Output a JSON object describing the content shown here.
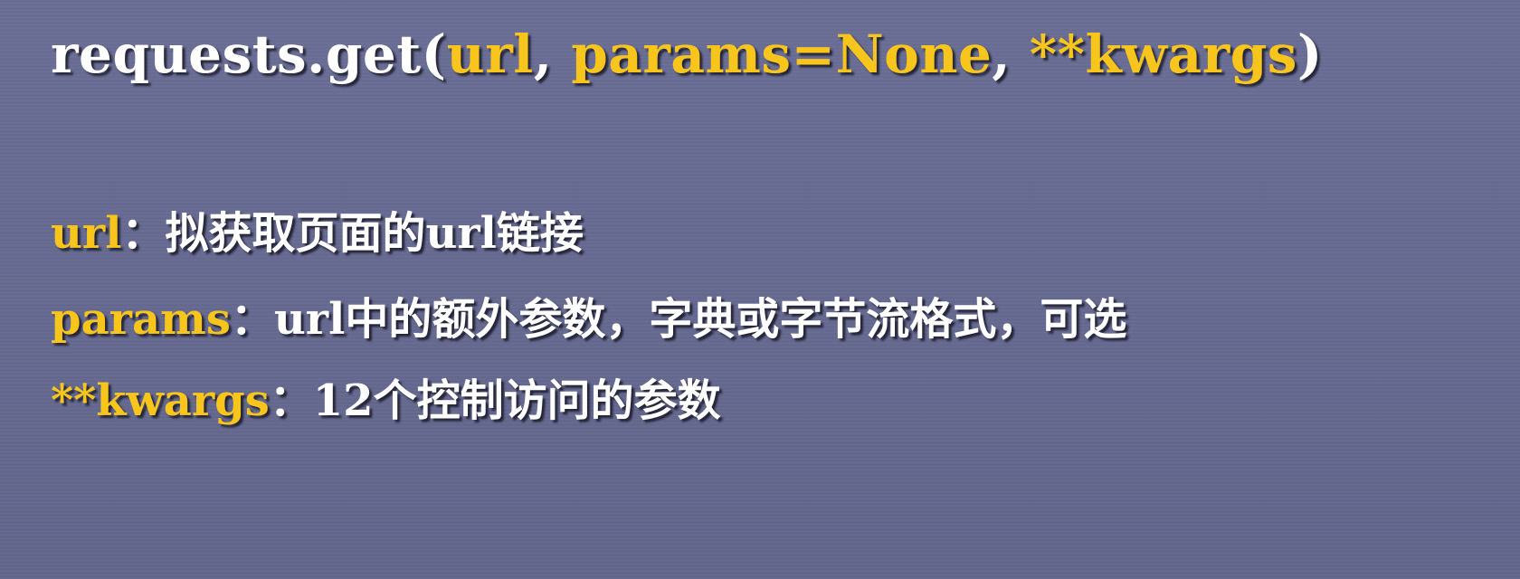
{
  "slide": {
    "signature": {
      "prefix": "requests.get(",
      "arg1": "url",
      "sep1": ", ",
      "arg2": "params=None",
      "sep2": ", ",
      "arg3": "**kwargs",
      "suffix": ")"
    },
    "params": [
      {
        "name": "url",
        "colon": "：",
        "desc_parts": [
          "拟获取页面的",
          "url",
          "链接"
        ]
      },
      {
        "name": "params",
        "colon": "：",
        "desc_parts": [
          "url",
          "中的额外参数，字典或字节流格式，可选"
        ]
      },
      {
        "name": "**kwargs",
        "colon": "：",
        "desc_parts": [
          "12",
          "个控制访问的参数"
        ]
      }
    ],
    "colors": {
      "background": "#666a91",
      "text": "#ffffff",
      "highlight": "#f8c51d"
    }
  }
}
